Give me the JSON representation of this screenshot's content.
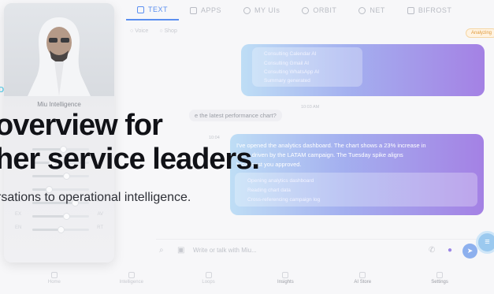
{
  "tabs": [
    {
      "label": "TEXT",
      "icon": "chat-icon",
      "active": true
    },
    {
      "label": "APPS",
      "icon": "grid-icon",
      "active": false
    },
    {
      "label": "MY UIs",
      "icon": "user-circle-icon",
      "active": false
    },
    {
      "label": "ORBIT",
      "icon": "orbit-icon",
      "active": false
    },
    {
      "label": "NET",
      "icon": "globe-icon",
      "active": false
    },
    {
      "label": "BIFROST",
      "icon": "database-icon",
      "active": false
    }
  ],
  "subbar": {
    "left": "Voice",
    "right": "Shop"
  },
  "status_chip": "Analyzing",
  "chat": {
    "tools_1": [
      "Consulting Calendar AI",
      "Consulting Gmail AI",
      "Consulting WhatsApp AI",
      "Summary generated"
    ],
    "time_1": "10:03 AM",
    "user_question": "e the latest performance chart?",
    "time_2": "10:04",
    "reply_lines": [
      "I've opened the analytics dashboard. The chart shows a 23% increase in",
      "ek — driven by the LATAM campaign. The Tuesday spike aligns",
      "broadcast you approved."
    ],
    "tools_2": [
      "Opening analytics dashboard",
      "Reading chart data",
      "Cross-referencing campaign log"
    ]
  },
  "input": {
    "placeholder": "Write or talk with Miu..."
  },
  "bottom_nav": [
    {
      "label": "Home",
      "strong": false
    },
    {
      "label": "Intelligence",
      "strong": false
    },
    {
      "label": "Loops",
      "strong": false
    },
    {
      "label": "Insights",
      "strong": true
    },
    {
      "label": "AI Store",
      "strong": true
    },
    {
      "label": "Settings",
      "strong": true
    }
  ],
  "phone": {
    "name": "Miu Intelligence",
    "sliders": [
      {
        "label": "",
        "value": "",
        "level": 0.55
      },
      {
        "label": "",
        "value": "",
        "level": 0.35
      },
      {
        "label": "",
        "value": "",
        "level": 0.6
      },
      {
        "label": "",
        "value": "",
        "level": 0.3
      },
      {
        "label": "EX",
        "value": "AV",
        "level": 0.75
      },
      {
        "label": "EX",
        "value": "AV",
        "level": 0.6
      },
      {
        "label": "EN",
        "value": "RT",
        "level": 0.5
      }
    ]
  },
  "hero": {
    "tag": "D",
    "line1": "overview for",
    "line2": "her service leaders.",
    "sub": "rsations to operational intelligence."
  },
  "colors": {
    "accent": "#5b8ff0",
    "tag": "#63c9e2",
    "bubble_start": "#b8dbf5",
    "bubble_end": "#9b74e2"
  }
}
